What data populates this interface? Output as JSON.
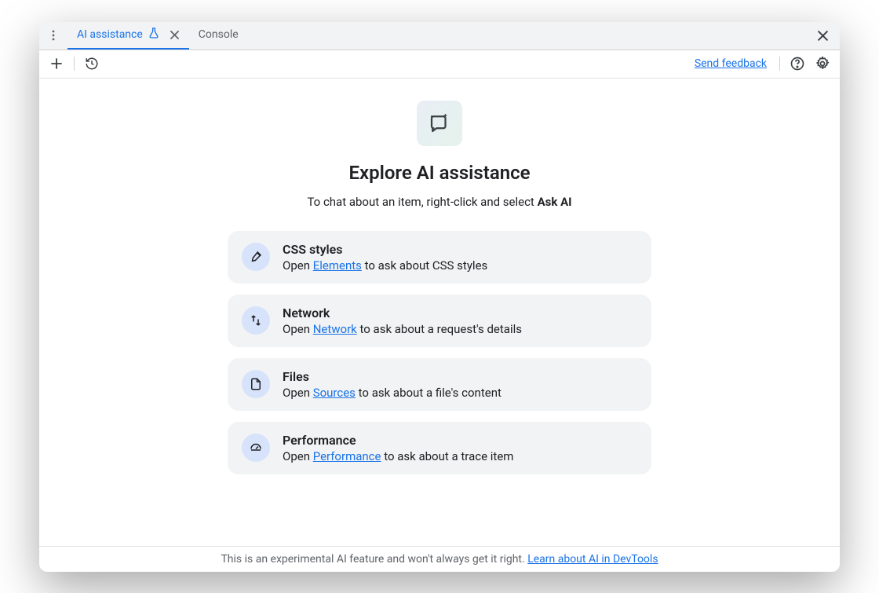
{
  "tabs": {
    "active": "AI assistance",
    "inactive": "Console"
  },
  "toolbar": {
    "feedback": "Send feedback"
  },
  "hero": {
    "heading": "Explore AI assistance",
    "sub_prefix": "To chat about an item, right-click and select ",
    "sub_bold": "Ask AI"
  },
  "cards": [
    {
      "icon": "brush-icon",
      "title": "CSS styles",
      "desc_prefix": "Open ",
      "link": "Elements",
      "desc_suffix": " to ask about CSS styles"
    },
    {
      "icon": "network-icon",
      "title": "Network",
      "desc_prefix": "Open ",
      "link": "Network",
      "desc_suffix": " to ask about a request's details"
    },
    {
      "icon": "file-icon",
      "title": "Files",
      "desc_prefix": "Open ",
      "link": "Sources",
      "desc_suffix": " to ask about a file's content"
    },
    {
      "icon": "performance-icon",
      "title": "Performance",
      "desc_prefix": "Open ",
      "link": "Performance",
      "desc_suffix": " to ask about a trace item"
    }
  ],
  "footer": {
    "text": "This is an experimental AI feature and won't always get it right. ",
    "link": "Learn about AI in DevTools"
  }
}
